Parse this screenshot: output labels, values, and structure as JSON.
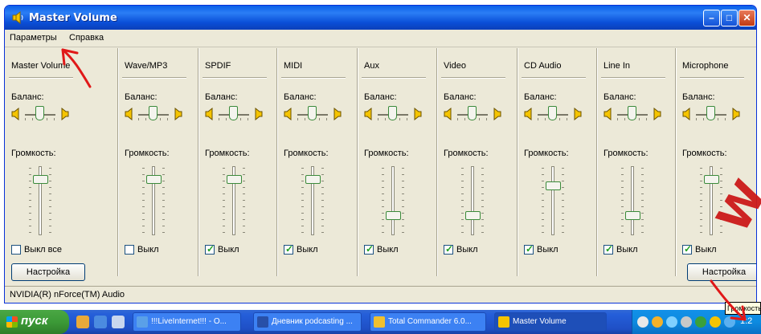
{
  "window": {
    "title": "Master Volume",
    "minimize": "–",
    "maximize": "□",
    "close": "✕"
  },
  "menu": {
    "items": [
      "Параметры",
      "Справка"
    ]
  },
  "balance_label": "Баланс:",
  "volume_label": "Громкость:",
  "columns": [
    {
      "name": "Master Volume",
      "mute_label": "Выкл все",
      "muted": false,
      "volume": 0.85
    },
    {
      "name": "Wave/MP3",
      "mute_label": "Выкл",
      "muted": false,
      "volume": 0.85
    },
    {
      "name": "SPDIF",
      "mute_label": "Выкл",
      "muted": true,
      "volume": 0.85
    },
    {
      "name": "MIDI",
      "mute_label": "Выкл",
      "muted": true,
      "volume": 0.85
    },
    {
      "name": "Aux",
      "mute_label": "Выкл",
      "muted": true,
      "volume": 0.25
    },
    {
      "name": "Video",
      "mute_label": "Выкл",
      "muted": true,
      "volume": 0.25
    },
    {
      "name": "CD Audio",
      "mute_label": "Выкл",
      "muted": true,
      "volume": 0.75
    },
    {
      "name": "Line In",
      "mute_label": "Выкл",
      "muted": true,
      "volume": 0.25
    },
    {
      "name": "Microphone",
      "mute_label": "Выкл",
      "muted": true,
      "volume": 0.85
    }
  ],
  "advanced_button": "Настройка",
  "statusbar": "NVIDIA(R) nForce(TM) Audio",
  "taskbar": {
    "start": "пуск",
    "tasks": [
      "!!!LiveInternet!!! - O...",
      "Дневник podcasting ...",
      "Total Commander 6.0...",
      "Master Volume"
    ],
    "clock": "1:2"
  },
  "tooltip": "Громкость",
  "watermark": "W",
  "colors": {
    "title_blue": "#0a5fe8",
    "face": "#ece9d8",
    "taskbar": "#245ed9",
    "start_green": "#3c9a37",
    "annotation_red": "#e01818"
  }
}
